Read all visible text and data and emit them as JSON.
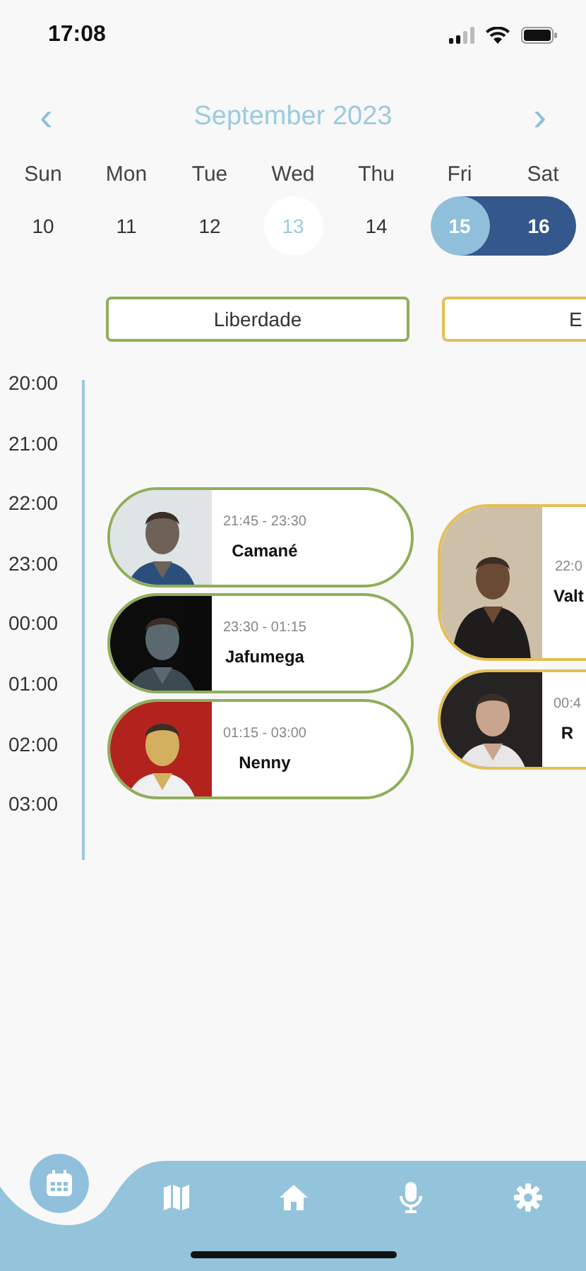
{
  "status_bar": {
    "time": "17:08"
  },
  "calendar": {
    "month": "September 2023",
    "prev": "‹",
    "next": "›",
    "days": [
      {
        "weekday": "Sun",
        "date": "10",
        "kind": "plain",
        "selected": false
      },
      {
        "weekday": "Mon",
        "date": "11",
        "kind": "plain",
        "selected": false
      },
      {
        "weekday": "Tue",
        "date": "12",
        "kind": "plain",
        "selected": false
      },
      {
        "weekday": "Wed",
        "date": "13",
        "kind": "today",
        "selected": false
      },
      {
        "weekday": "Thu",
        "date": "14",
        "kind": "plain",
        "selected": false
      },
      {
        "weekday": "Fri",
        "date": "15",
        "kind": "range-start",
        "selected": true
      },
      {
        "weekday": "Sat",
        "date": "16",
        "kind": "range-end",
        "selected": true
      }
    ]
  },
  "stages": [
    {
      "name": "Liberdade",
      "color": "#8fae5a",
      "acts": [
        {
          "time": "21:45 - 23:30",
          "artist": "Camané",
          "kind": "picture"
        },
        {
          "time": "23:30 - 01:15",
          "artist": "Jafumega",
          "kind": "picture"
        },
        {
          "time": "01:15 - 03:00",
          "artist": "Nenny",
          "kind": "picture"
        }
      ]
    },
    {
      "name": "E",
      "color": "#e4bf55",
      "acts": [
        {
          "time": "22:0",
          "artist": "Valt",
          "kind": "picture"
        },
        {
          "time": "00:4",
          "artist": "R",
          "kind": "picture"
        }
      ]
    }
  ],
  "timeline": {
    "hours": [
      "20:00",
      "21:00",
      "22:00",
      "23:00",
      "00:00",
      "01:00",
      "02:00",
      "03:00"
    ]
  },
  "tab_bar": [
    {
      "kind": "calendar",
      "selected": true
    },
    {
      "kind": "map",
      "selected": false
    },
    {
      "kind": "home",
      "selected": false
    },
    {
      "kind": "mic",
      "selected": false
    },
    {
      "kind": "settings",
      "selected": false
    }
  ]
}
